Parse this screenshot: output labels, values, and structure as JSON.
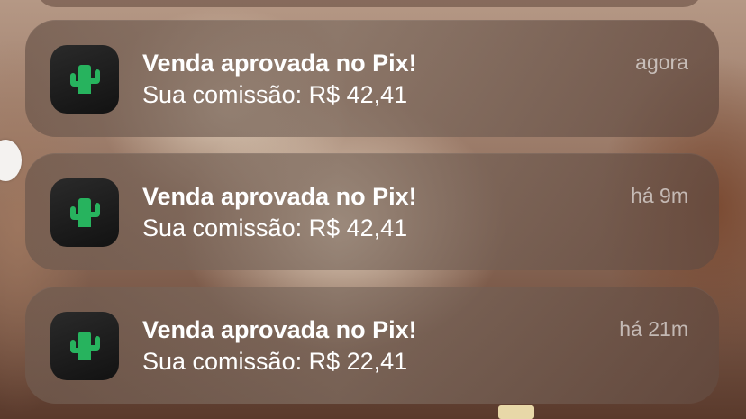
{
  "notifications": [
    {
      "app_icon": "cactus-icon",
      "title": "Venda aprovada no Pix!",
      "body": "Sua comissão: R$ 42,41",
      "time": "agora"
    },
    {
      "app_icon": "cactus-icon",
      "title": "Venda aprovada no Pix!",
      "body": "Sua comissão: R$ 42,41",
      "time": "há 9m"
    },
    {
      "app_icon": "cactus-icon",
      "title": "Venda aprovada no Pix!",
      "body": "Sua comissão: R$ 22,41",
      "time": "há 21m"
    }
  ],
  "colors": {
    "cactus_green": "#27b35e",
    "icon_background": "#1a1a1a"
  }
}
